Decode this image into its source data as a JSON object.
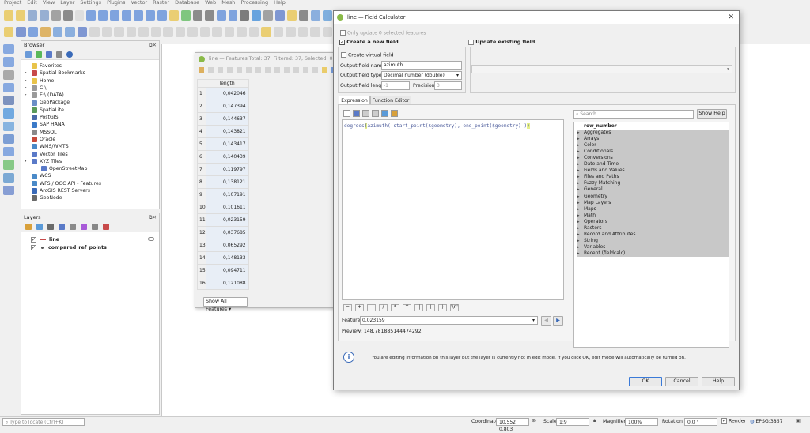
{
  "menu": [
    "Project",
    "Edit",
    "View",
    "Layer",
    "Settings",
    "Plugins",
    "Vector",
    "Raster",
    "Database",
    "Web",
    "Mesh",
    "Processing",
    "Help"
  ],
  "browser": {
    "title": "Browser",
    "items": [
      {
        "label": "Favorites",
        "indent": 0,
        "arrow": "",
        "color": "#e8c34a"
      },
      {
        "label": "Spatial Bookmarks",
        "indent": 0,
        "arrow": "▸",
        "color": "#c84a4a"
      },
      {
        "label": "Home",
        "indent": 0,
        "arrow": "▸",
        "color": "#e8c34a"
      },
      {
        "label": "C:\\",
        "indent": 0,
        "arrow": "▸",
        "color": "#9a9a9a"
      },
      {
        "label": "E:\\ (DATA)",
        "indent": 0,
        "arrow": "▸",
        "color": "#9a9a9a"
      },
      {
        "label": "GeoPackage",
        "indent": 0,
        "arrow": "",
        "color": "#6b8ec6"
      },
      {
        "label": "SpatiaLite",
        "indent": 0,
        "arrow": "",
        "color": "#5a9a5a"
      },
      {
        "label": "PostGIS",
        "indent": 0,
        "arrow": "",
        "color": "#4a6aa8"
      },
      {
        "label": "SAP HANA",
        "indent": 0,
        "arrow": "",
        "color": "#3a7ac8"
      },
      {
        "label": "MSSQL",
        "indent": 0,
        "arrow": "",
        "color": "#8a8a8a"
      },
      {
        "label": "Oracle",
        "indent": 0,
        "arrow": "",
        "color": "#c84a3a"
      },
      {
        "label": "WMS/WMTS",
        "indent": 0,
        "arrow": "",
        "color": "#4a8ac8"
      },
      {
        "label": "Vector Tiles",
        "indent": 0,
        "arrow": "",
        "color": "#5a7ac8"
      },
      {
        "label": "XYZ Tiles",
        "indent": 0,
        "arrow": "▾",
        "color": "#5a7ac8"
      },
      {
        "label": "OpenStreetMap",
        "indent": 1,
        "arrow": "",
        "color": "#5a7ac8"
      },
      {
        "label": "WCS",
        "indent": 0,
        "arrow": "",
        "color": "#4a8ac8"
      },
      {
        "label": "WFS / OGC API - Features",
        "indent": 0,
        "arrow": "",
        "color": "#4a8ac8"
      },
      {
        "label": "ArcGIS REST Servers",
        "indent": 0,
        "arrow": "",
        "color": "#3a6ab8"
      },
      {
        "label": "GeoNode",
        "indent": 0,
        "arrow": "",
        "color": "#6a6a6a"
      }
    ]
  },
  "layers": {
    "title": "Layers",
    "items": [
      {
        "label": "line",
        "checked": true,
        "bold": true
      },
      {
        "label": "compared_ref_points",
        "checked": true,
        "bold": true
      }
    ]
  },
  "attribute_table": {
    "title": "line — Features Total: 37, Filtered: 37, Selected: 0",
    "column": "length",
    "rows": [
      {
        "n": "1",
        "v": "0,042046"
      },
      {
        "n": "2",
        "v": "0,147394"
      },
      {
        "n": "3",
        "v": "0,144637"
      },
      {
        "n": "4",
        "v": "0,143821"
      },
      {
        "n": "5",
        "v": "0,143417"
      },
      {
        "n": "6",
        "v": "0,140439"
      },
      {
        "n": "7",
        "v": "0,119797"
      },
      {
        "n": "8",
        "v": "0,138121"
      },
      {
        "n": "9",
        "v": "0,107191"
      },
      {
        "n": "10",
        "v": "0,101611"
      },
      {
        "n": "11",
        "v": "0,023159"
      },
      {
        "n": "12",
        "v": "0,037685"
      },
      {
        "n": "13",
        "v": "0,065292"
      },
      {
        "n": "14",
        "v": "0,148133"
      },
      {
        "n": "15",
        "v": "0,094711"
      },
      {
        "n": "16",
        "v": "0,121088"
      }
    ],
    "show_all": "Show All Features"
  },
  "field_calc": {
    "title": "line — Field Calculator",
    "only_update": "Only update 0 selected features",
    "create_new": "Create a new field",
    "update_existing": "Update existing field",
    "create_virtual": "Create virtual field",
    "out_name_label": "Output field name",
    "out_name_value": "azimuth",
    "out_type_label": "Output field type",
    "out_type_value": "Decimal number (double)",
    "out_len_label": "Output field length",
    "out_len_value": "-1",
    "precision_label": "Precision",
    "precision_value": "3",
    "tab_expression": "Expression",
    "tab_function_editor": "Function Editor",
    "expression_a": "degrees",
    "expression_b": "azimuth( start_point($geometry), end_point($geometry) )",
    "expression_c": ")",
    "search_placeholder": "Search...",
    "show_help": "Show Help",
    "functions": [
      {
        "label": "row_number",
        "arrow": ""
      },
      {
        "label": "Aggregates",
        "arrow": "▸"
      },
      {
        "label": "Arrays",
        "arrow": "▸"
      },
      {
        "label": "Color",
        "arrow": "▸"
      },
      {
        "label": "Conditionals",
        "arrow": "▸"
      },
      {
        "label": "Conversions",
        "arrow": "▸"
      },
      {
        "label": "Date and Time",
        "arrow": "▸"
      },
      {
        "label": "Fields and Values",
        "arrow": "▸"
      },
      {
        "label": "Files and Paths",
        "arrow": "▸"
      },
      {
        "label": "Fuzzy Matching",
        "arrow": "▸"
      },
      {
        "label": "General",
        "arrow": "▸"
      },
      {
        "label": "Geometry",
        "arrow": "▸"
      },
      {
        "label": "Map Layers",
        "arrow": "▸"
      },
      {
        "label": "Maps",
        "arrow": "▸"
      },
      {
        "label": "Math",
        "arrow": "▸"
      },
      {
        "label": "Operators",
        "arrow": "▸"
      },
      {
        "label": "Rasters",
        "arrow": "▸"
      },
      {
        "label": "Record and Attributes",
        "arrow": "▸"
      },
      {
        "label": "String",
        "arrow": "▸"
      },
      {
        "label": "Variables",
        "arrow": "▸"
      },
      {
        "label": "Recent (fieldcalc)",
        "arrow": "▸"
      }
    ],
    "operators": [
      "=",
      "+",
      "-",
      "/",
      "*",
      "^",
      "||",
      "(",
      ")",
      "'\\n'"
    ],
    "feature_label": "Feature",
    "feature_value": "0,023159",
    "preview_label": "Preview:",
    "preview_value": "148,781885144474292",
    "info_text": "You are editing information on this layer but the layer is currently not in edit mode. If you click OK, edit mode will automatically be turned on.",
    "ok": "OK",
    "cancel": "Cancel",
    "help": "Help"
  },
  "statusbar": {
    "locate_placeholder": "Type to locate (Ctrl+K)",
    "coordinate_label": "Coordinate",
    "coordinate_value": "10,552 0,803",
    "scale_label": "Scale",
    "scale_value": "1:9",
    "magnifier_label": "Magnifier",
    "magnifier_value": "100%",
    "rotation_label": "Rotation",
    "rotation_value": "0,0 °",
    "render_label": "Render",
    "crs": "EPSG:3857"
  }
}
